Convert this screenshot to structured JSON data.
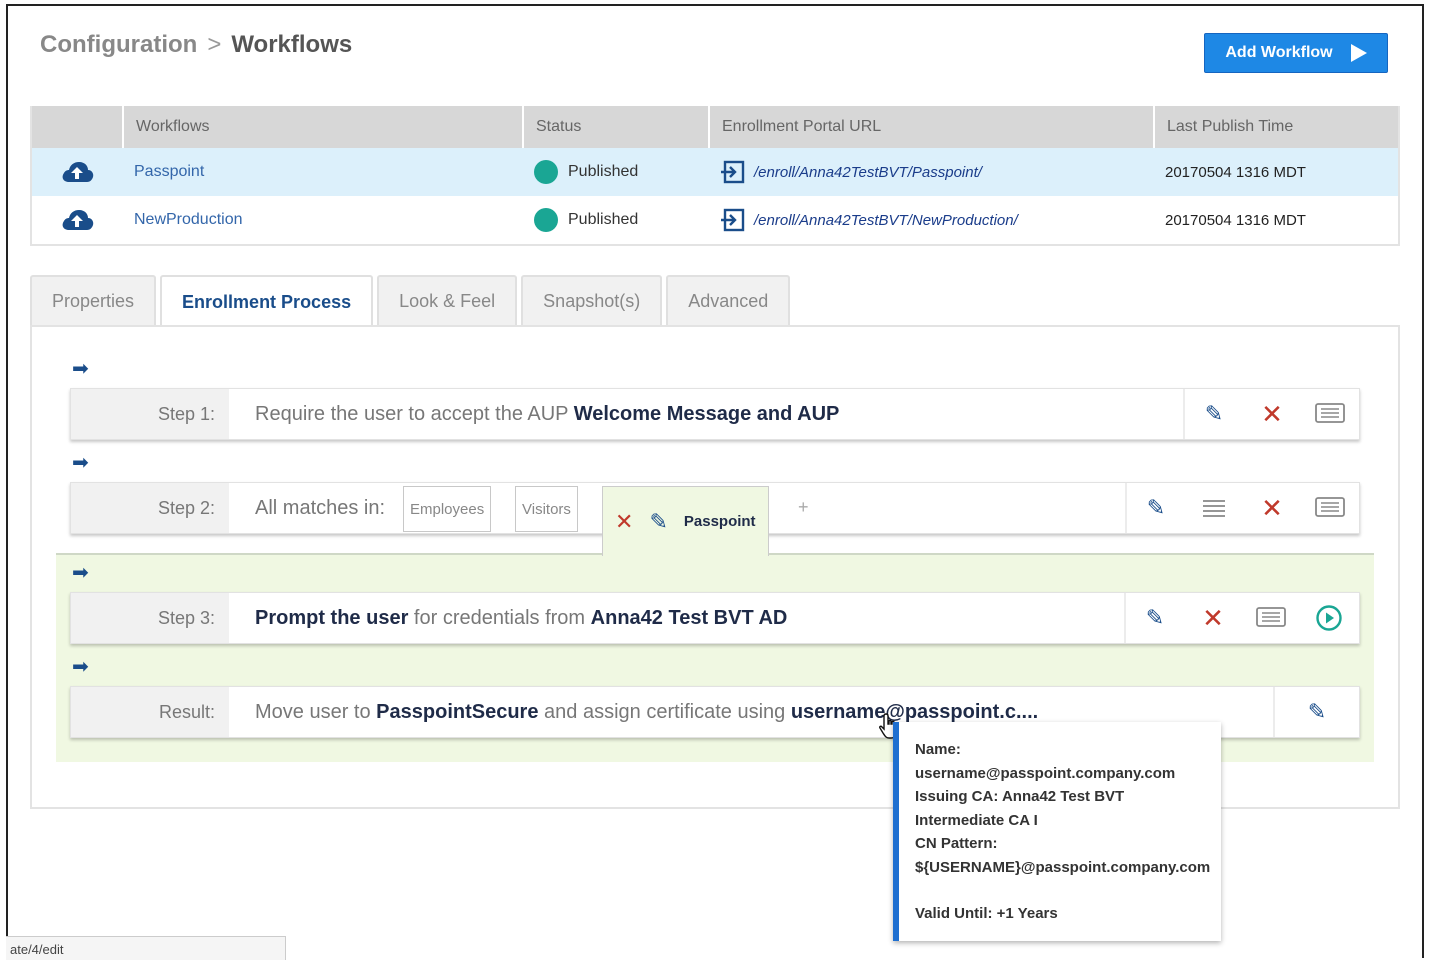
{
  "breadcrumb": {
    "parent": "Configuration",
    "separator": ">",
    "current": "Workflows"
  },
  "add_button": {
    "label": "Add Workflow"
  },
  "table": {
    "headers": [
      "Workflows",
      "Status",
      "Enrollment Portal URL",
      "Last Publish Time"
    ],
    "rows": [
      {
        "name": "Passpoint",
        "status": "Published",
        "url": "/enroll/Anna42TestBVT/Passpoint/",
        "time": "20170504 1316 MDT"
      },
      {
        "name": "NewProduction",
        "status": "Published",
        "url": "/enroll/Anna42TestBVT/NewProduction/",
        "time": "20170504 1316 MDT"
      }
    ]
  },
  "tabs": [
    "Properties",
    "Enrollment Process",
    "Look & Feel",
    "Snapshot(s)",
    "Advanced"
  ],
  "steps": {
    "step1": {
      "label": "Step 1:",
      "t1": "Require the user to accept the AUP ",
      "b1": "Welcome Message and AUP"
    },
    "step2": {
      "label": "Step 2:",
      "t1": "All matches in:",
      "chips": [
        "Employees",
        "Visitors",
        "Passpoint"
      ],
      "plus": "+"
    },
    "step3": {
      "label": "Step 3:",
      "b1": "Prompt the user",
      "t1": " for credentials from ",
      "b2": "Anna42 Test BVT AD"
    },
    "result": {
      "label": "Result:",
      "t1": "Move user to ",
      "b1": "PasspointSecure",
      "t2": " and assign certificate using ",
      "b2": "username@passpoint.c...."
    }
  },
  "tooltip": {
    "lines": [
      "Name:",
      "username@passpoint.company.com",
      "Issuing CA: Anna42 Test BVT",
      "Intermediate CA I",
      "CN Pattern:",
      "${USERNAME}@passpoint.company.com"
    ],
    "valid": "Valid Until: +1 Years"
  },
  "status_bar": "ate/4/edit",
  "colors": {
    "accent": "#1e88e5",
    "published": "#1aa694",
    "selected_row": "#dcf0fb",
    "green_zone": "#f0f8e2"
  }
}
